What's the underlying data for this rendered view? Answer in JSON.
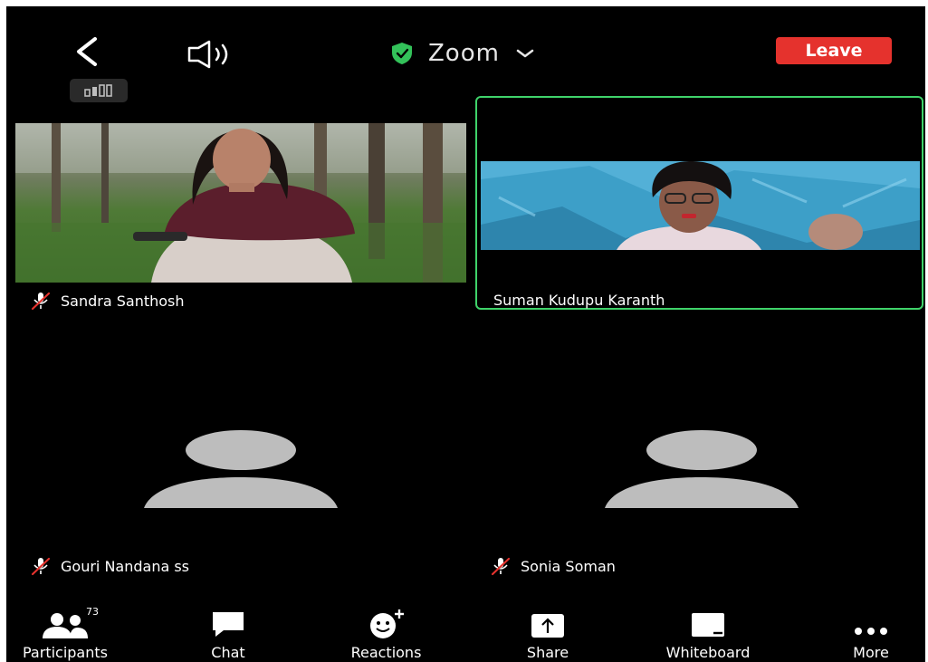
{
  "header": {
    "meeting_title": "Zoom",
    "leave_label": "Leave"
  },
  "tiles": [
    {
      "name": "Sandra Santhosh",
      "muted": true,
      "video": true
    },
    {
      "name": "Suman Kudupu Karanth",
      "muted": false,
      "video": true,
      "active_speaker": true
    },
    {
      "name": "Gouri Nandana ss",
      "muted": true,
      "video": false
    },
    {
      "name": "Sonia Soman",
      "muted": true,
      "video": false
    }
  ],
  "toolbar": {
    "participants_label": "Participants",
    "participants_count": "73",
    "chat_label": "Chat",
    "reactions_label": "Reactions",
    "share_label": "Share",
    "whiteboard_label": "Whiteboard",
    "more_label": "More"
  },
  "colors": {
    "background": "#000000",
    "leave": "#e5322d",
    "active_speaker_border": "#3fd36a",
    "secure_shield": "#33c25a",
    "avatar": "#bdbdbd",
    "muted_mic": "#e5322d"
  },
  "icons": [
    "back-icon",
    "speaker-icon",
    "shield-check-icon",
    "chevron-down-icon",
    "signal-bars-icon",
    "mic-off-icon",
    "participants-icon",
    "chat-icon",
    "reactions-icon",
    "share-icon",
    "whiteboard-icon",
    "more-icon"
  ]
}
